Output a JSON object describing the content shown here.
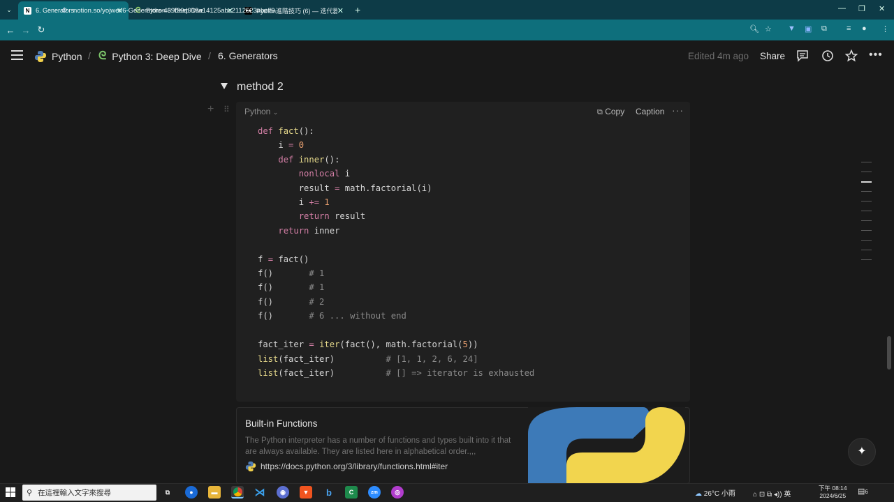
{
  "browser": {
    "tabs": [
      {
        "label": "6. Generators",
        "icon": "notion-icon",
        "active": true
      },
      {
        "label": "Python 3: Deep Dive",
        "icon": "deepdive-icon",
        "active": false
      },
      {
        "label": "Python進階技巧 (6) — 迭代器",
        "icon": "medium-icon",
        "active": false
      }
    ],
    "new_tab": "+",
    "url": "notion.so/yojwei/6-Generators-469f90d919a14125abc2112523abcff9"
  },
  "notion": {
    "breadcrumb": [
      "Python",
      "Python 3: Deep Dive",
      "6. Generators"
    ],
    "breadcrumb_sep": "/",
    "edited": "Edited 4m ago",
    "share": "Share",
    "toggle_title": "method 2",
    "code": {
      "language": "Python",
      "copy": "Copy",
      "caption": "Caption",
      "more": "···"
    },
    "bookmark": {
      "title": "Built-in Functions",
      "description": "The Python interpreter has a number of functions and types built into it that are always available. They are listed here in alphabetical order.,,,",
      "url": "https://docs.python.org/3/library/functions.html#iter"
    }
  },
  "taskbar": {
    "search_placeholder": "在這裡輸入文字來搜尋",
    "weather": "26°C  小雨",
    "ime": "英",
    "time": "下午 08:14",
    "date": "2024/6/25",
    "notifications": "6"
  },
  "colors": {
    "tab_active": "#0e6f7c",
    "tabstrip": "#0d3b47",
    "page_bg": "#191919",
    "code_bg": "#202020",
    "keyword": "#d47fa6",
    "number": "#e9a070",
    "comment": "#8a8a8a"
  }
}
